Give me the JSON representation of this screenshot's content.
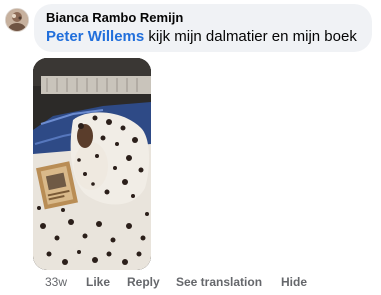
{
  "comment": {
    "author": "Bianca Rambo Remijn",
    "mention": "Peter Willems",
    "text": "kijk mijn dalmatier en mijn boek",
    "age": "33w",
    "actions": {
      "like": "Like",
      "reply": "Reply",
      "see_translation": "See translation",
      "hide": "Hide"
    }
  },
  "colors": {
    "bubble": "#f0f2f5",
    "mention": "#216fdb",
    "action_text": "#65676b"
  }
}
